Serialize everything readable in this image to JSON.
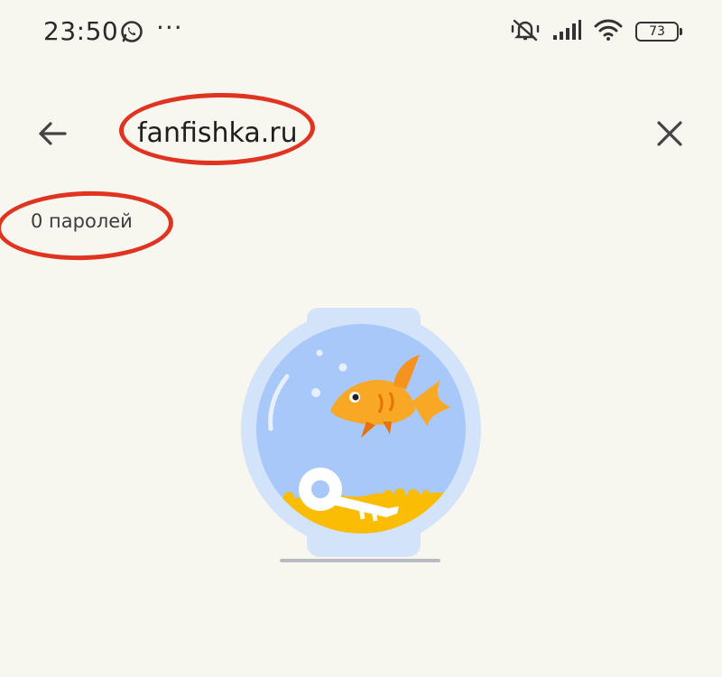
{
  "status_bar": {
    "time": "23:50",
    "more": "···",
    "battery": "73",
    "icons": [
      "whatsapp-icon",
      "silent-icon",
      "signal-icon",
      "wifi-icon",
      "battery-icon"
    ]
  },
  "search": {
    "query": "fanfishka.ru"
  },
  "results": {
    "count_label": "0 паролей"
  },
  "colors": {
    "background": "#f7f7f0",
    "annotation_red": "#e03421",
    "bowl_blue": "#cfe1f8",
    "water_blue": "#a8c7fa",
    "fish_orange": "#f9a825",
    "gravel_yellow": "#fbc02d"
  },
  "icons": {
    "back": "arrow-back-icon",
    "clear": "close-icon",
    "illustration": "fishbowl-key-illustration"
  }
}
